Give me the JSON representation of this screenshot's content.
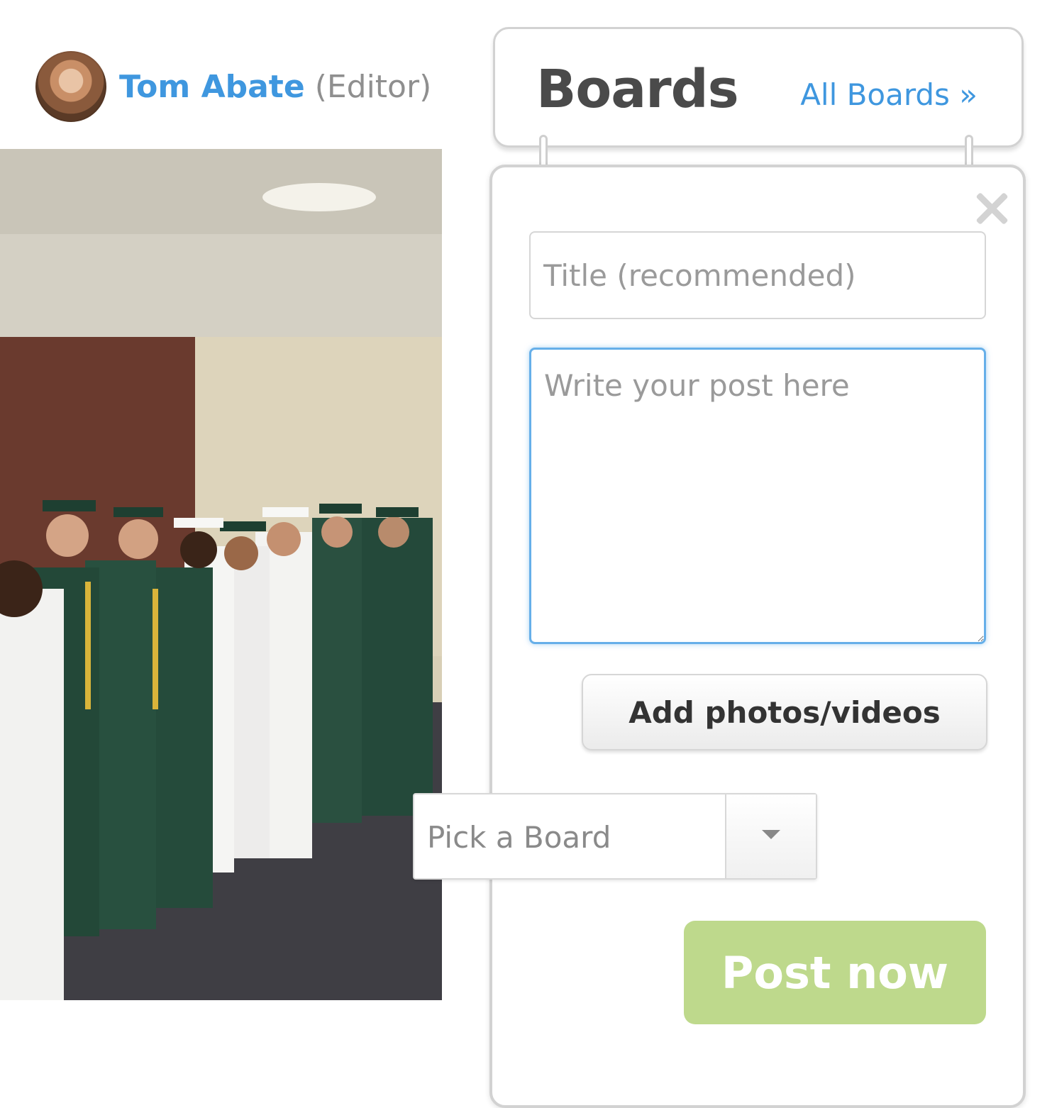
{
  "author": {
    "name": "Tom Abate",
    "role": "(Editor)"
  },
  "boards": {
    "title": "Boards",
    "all_boards_link": "All Boards »"
  },
  "composer": {
    "title_placeholder": "Title (recommended)",
    "post_placeholder": "Write your post here",
    "add_media_label": "Add photos/videos",
    "board_select_label": "Pick a Board",
    "post_button_label": "Post now"
  },
  "colors": {
    "link_blue": "#3f97df",
    "post_button_green": "#bed98c",
    "focus_blue": "#66afe9"
  },
  "icons": [
    "close-icon",
    "chevron-down-icon"
  ]
}
